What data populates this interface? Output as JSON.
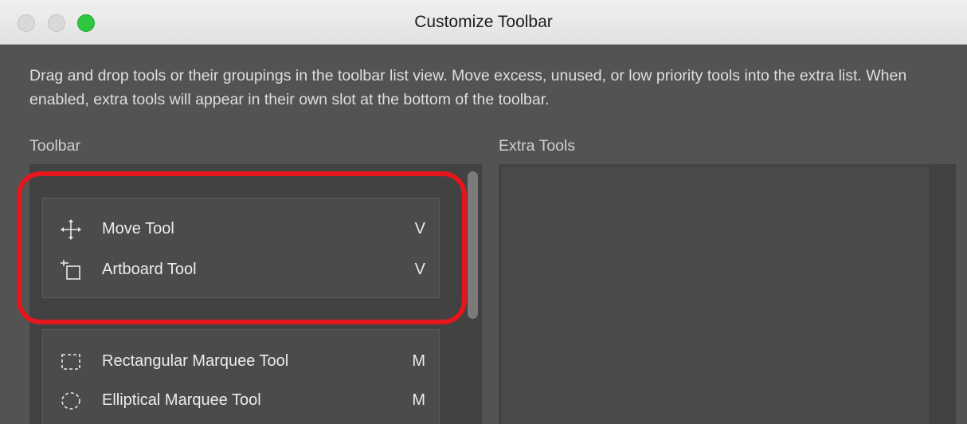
{
  "window": {
    "title": "Customize Toolbar",
    "controls": [
      "close",
      "minimize",
      "zoom"
    ]
  },
  "description": "Drag and drop tools or their groupings in the toolbar list view. Move excess, unused, or low priority tools into the extra list. When enabled, extra tools will appear in their own slot at the bottom of the toolbar.",
  "toolbar": {
    "label": "Toolbar",
    "groups": [
      {
        "tools": [
          {
            "name": "Move Tool",
            "key": "V",
            "icon": "move-icon"
          },
          {
            "name": "Artboard Tool",
            "key": "V",
            "icon": "artboard-icon"
          }
        ]
      },
      {
        "tools": [
          {
            "name": "Rectangular Marquee Tool",
            "key": "M",
            "icon": "rectangular-marquee-icon"
          },
          {
            "name": "Elliptical Marquee Tool",
            "key": "M",
            "icon": "elliptical-marquee-icon"
          }
        ]
      }
    ]
  },
  "extra_tools": {
    "label": "Extra Tools"
  },
  "colors": {
    "panel_bg": "#535353",
    "list_bg": "#424242",
    "group_bg": "#4b4b4b",
    "highlight": "#e5171e",
    "zoom_button": "#2dc83f"
  }
}
